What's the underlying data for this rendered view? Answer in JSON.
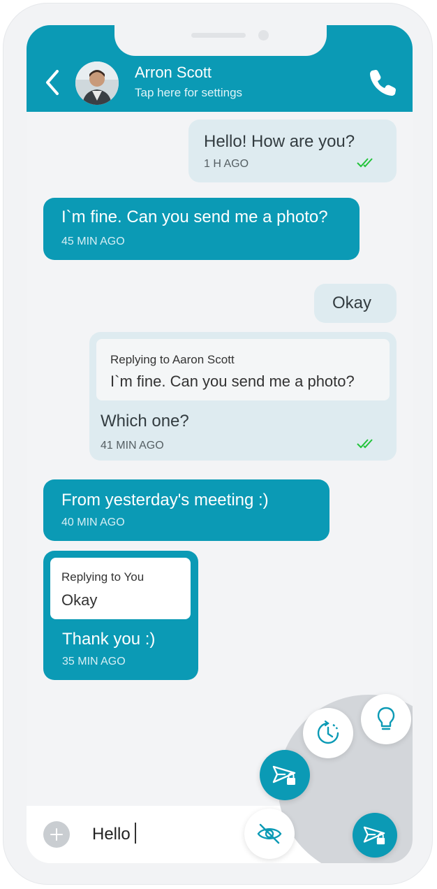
{
  "header": {
    "contact_name": "Arron Scott",
    "subtitle": "Tap here for settings",
    "accent_color": "#0b9ab5"
  },
  "messages": [
    {
      "direction": "out",
      "text": "Hello! How are you?",
      "time": "1 H AGO",
      "read": true
    },
    {
      "direction": "in",
      "text": "I`m fine. Can you send me a photo?",
      "time": "45 MIN AGO"
    },
    {
      "direction": "out",
      "text": "Okay"
    },
    {
      "direction": "out",
      "reply_label": "Replying to Aaron Scott",
      "reply_quote": "I`m fine. Can you send me a photo?",
      "text": "Which one?",
      "time": "41 MIN AGO",
      "read": true
    },
    {
      "direction": "in",
      "text": "From yesterday's meeting :)",
      "time": "40 MIN AGO"
    },
    {
      "direction": "in",
      "reply_label": "Replying to You",
      "reply_quote": "Okay",
      "text": "Thank you :)",
      "time": "35 MIN AGO"
    }
  ],
  "composer": {
    "value": "Hello",
    "placeholder": ""
  },
  "radial_menu": {
    "items": [
      {
        "icon": "lightbulb-icon"
      },
      {
        "icon": "timer-icon"
      },
      {
        "icon": "secure-send-icon"
      },
      {
        "icon": "eye-off-icon"
      }
    ]
  },
  "send": {
    "icon": "secure-send-icon"
  }
}
